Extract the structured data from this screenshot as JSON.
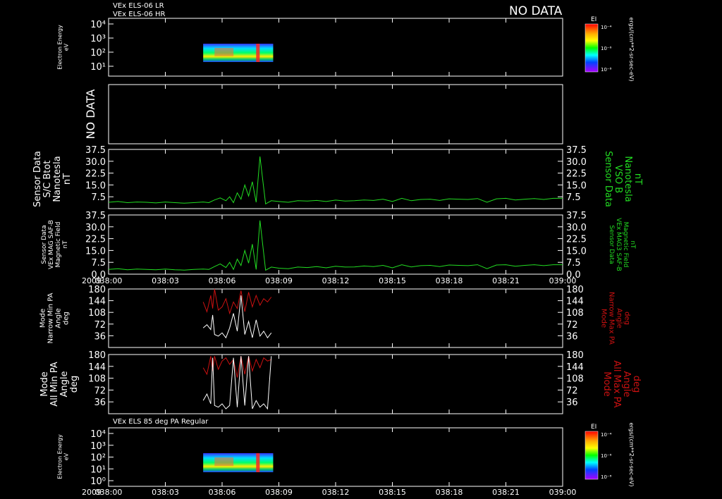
{
  "header": {
    "line1": "VEx ELS-06 LR",
    "line2": "VEx ELS-06 HR",
    "no_data": "NO DATA"
  },
  "colorbar": {
    "label": "EI",
    "ticks": [
      "10⁻⁴",
      "10⁻⁶",
      "10⁻⁸"
    ],
    "unit_label": "ergs/(cm**2-sr-sec-eV)"
  },
  "time_axis": {
    "year": "2009",
    "ticks": [
      "038:00",
      "038:03",
      "038:06",
      "038:09",
      "038:12",
      "038:15",
      "038:18",
      "038:21",
      "039:00"
    ]
  },
  "colors": {
    "green": "#22dd22",
    "red": "#cc1111",
    "white": "#ffffff",
    "background": "#000000"
  },
  "chart_data": [
    {
      "type": "heatmap",
      "panel": "electron-spectrogram-top",
      "left_label": [
        "Electron Energy",
        "eV"
      ],
      "y_ticks": [
        "10⁴",
        "10³",
        "10²",
        "10¹"
      ],
      "time_range": [
        "038:05",
        "038:09"
      ]
    },
    {
      "type": "empty",
      "panel": "no-data-panel",
      "left_label": [
        "NO DATA"
      ]
    },
    {
      "type": "line",
      "panel": "btot-panel",
      "left_label": [
        "Sensor Data",
        "S/C Btot",
        "Nanotesla",
        "nT"
      ],
      "right_label": [
        "Sensor Data",
        "VSO B",
        "Nanotesla",
        "nT"
      ],
      "y_ticks": [
        "37.5",
        "30.0",
        "22.5",
        "15.0",
        "7.5"
      ],
      "ylim": [
        0,
        37.5
      ],
      "series": [
        {
          "color": "#22dd22",
          "x": [
            0,
            0.5,
            1,
            1.5,
            2,
            2.5,
            3,
            3.5,
            4,
            4.5,
            5,
            5.3,
            5.6,
            5.9,
            6.2,
            6.4,
            6.6,
            6.8,
            7.0,
            7.2,
            7.4,
            7.6,
            7.8,
            8.0,
            8.3,
            8.6,
            9,
            9.5,
            10,
            10.5,
            11,
            11.5,
            12,
            12.5,
            13,
            13.5,
            14,
            14.5,
            15,
            15.5,
            16,
            16.5,
            17,
            17.5,
            18,
            18.5,
            19,
            19.5,
            20,
            20.5,
            21,
            21.5,
            22,
            22.5,
            23,
            23.5,
            24
          ],
          "values": [
            4,
            4.5,
            3.8,
            4.2,
            4,
            3.6,
            4.2,
            3.8,
            3.5,
            3.8,
            4.2,
            3.8,
            5.5,
            6.8,
            5,
            7.5,
            3.8,
            10,
            6,
            15,
            8,
            17,
            4,
            33,
            3,
            5,
            4.5,
            4,
            5,
            4.8,
            5.2,
            4.5,
            5.4,
            4.8,
            5,
            5.5,
            5.2,
            6,
            4.5,
            6.5,
            5,
            5.8,
            6,
            5.2,
            6.2,
            6,
            5.8,
            6.4,
            4,
            6.2,
            6.5,
            5.5,
            6,
            6.4,
            5.8,
            6.5,
            6.5
          ]
        }
      ]
    },
    {
      "type": "line",
      "panel": "mag-field-panel",
      "left_label": [
        "Sensor Data",
        "VEx MAG SAF-B",
        "Magnetic Field",
        "nT"
      ],
      "right_label": [
        "Sensor Data",
        "VEx MAG3 SAF-B",
        "Magnetic Field",
        "nT"
      ],
      "y_ticks": [
        "37.5",
        "30.0",
        "22.5",
        "15.0",
        "7.5",
        "0.0"
      ],
      "ylim": [
        0,
        37.5
      ],
      "series": [
        {
          "color": "#22dd22",
          "x": [
            0,
            0.5,
            1,
            1.5,
            2,
            2.5,
            3,
            3.5,
            4,
            4.5,
            5,
            5.3,
            5.6,
            5.9,
            6.2,
            6.4,
            6.6,
            6.8,
            7.0,
            7.2,
            7.4,
            7.6,
            7.8,
            8.0,
            8.3,
            8.6,
            9,
            9.5,
            10,
            10.5,
            11,
            11.5,
            12,
            12.5,
            13,
            13.5,
            14,
            14.5,
            15,
            15.5,
            16,
            16.5,
            17,
            17.5,
            18,
            18.5,
            19,
            19.5,
            20,
            20.5,
            21,
            21.5,
            22,
            22.5,
            23,
            23.5,
            24
          ],
          "values": [
            3,
            3.5,
            2.8,
            3.2,
            3,
            2.8,
            3.2,
            2.8,
            2.6,
            3,
            3.2,
            3,
            4.8,
            6.5,
            4.2,
            7.5,
            3,
            9.5,
            5.5,
            15,
            7,
            19,
            3,
            34,
            2.5,
            4.5,
            3.8,
            3.5,
            4.5,
            4.2,
            4.8,
            4,
            5,
            4.5,
            4.6,
            5.2,
            4.8,
            5.6,
            4,
            6,
            4.6,
            5.4,
            5.6,
            4.8,
            5.8,
            5.6,
            5.4,
            6,
            3.5,
            5.8,
            6,
            5,
            5.6,
            6,
            5.4,
            6,
            6
          ]
        }
      ]
    },
    {
      "type": "line",
      "panel": "narrow-pa-panel",
      "left_label": [
        "Mode",
        "Narrow Min PA",
        "Angle",
        "deg"
      ],
      "right_label": [
        "Mode",
        "Narrow Max PA",
        "Angle",
        "deg"
      ],
      "y_ticks": [
        "180",
        "144",
        "108",
        "72",
        "36"
      ],
      "ylim": [
        0,
        180
      ],
      "series": [
        {
          "color": "#cc1111",
          "x": [
            5.0,
            5.2,
            5.4,
            5.5,
            5.6,
            5.8,
            6.0,
            6.2,
            6.4,
            6.6,
            6.8,
            7.0,
            7.2,
            7.4,
            7.6,
            7.8,
            8.0,
            8.2,
            8.4,
            8.6
          ],
          "values": [
            140,
            110,
            160,
            120,
            180,
            115,
            125,
            150,
            105,
            140,
            120,
            175,
            110,
            170,
            125,
            160,
            130,
            150,
            140,
            155
          ]
        },
        {
          "color": "#ffffff",
          "x": [
            5.0,
            5.2,
            5.4,
            5.5,
            5.6,
            5.8,
            6.0,
            6.2,
            6.4,
            6.6,
            6.8,
            7.0,
            7.2,
            7.4,
            7.6,
            7.8,
            8.0,
            8.2,
            8.4,
            8.6
          ],
          "values": [
            60,
            70,
            55,
            100,
            40,
            35,
            45,
            30,
            60,
            105,
            50,
            160,
            40,
            80,
            30,
            85,
            35,
            50,
            30,
            45
          ]
        }
      ]
    },
    {
      "type": "line",
      "panel": "all-pa-panel",
      "left_label": [
        "Mode",
        "All Min PA",
        "Angle",
        "deg"
      ],
      "right_label": [
        "Mode",
        "All Max PA",
        "Angle",
        "deg"
      ],
      "y_ticks": [
        "180",
        "144",
        "108",
        "72",
        "36"
      ],
      "ylim": [
        0,
        180
      ],
      "series": [
        {
          "color": "#cc1111",
          "x": [
            5.0,
            5.2,
            5.4,
            5.5,
            5.6,
            5.8,
            6.0,
            6.2,
            6.4,
            6.6,
            6.8,
            7.0,
            7.2,
            7.4,
            7.6,
            7.8,
            8.0,
            8.2,
            8.4,
            8.6
          ],
          "values": [
            140,
            120,
            175,
            130,
            175,
            135,
            160,
            170,
            150,
            165,
            110,
            175,
            120,
            175,
            130,
            165,
            140,
            170,
            160,
            165
          ]
        },
        {
          "color": "#ffffff",
          "x": [
            5.0,
            5.2,
            5.4,
            5.5,
            5.6,
            5.8,
            6.0,
            6.2,
            6.4,
            6.6,
            6.8,
            7.0,
            7.2,
            7.4,
            7.6,
            7.8,
            8.0,
            8.2,
            8.4,
            8.6
          ],
          "values": [
            40,
            60,
            30,
            170,
            25,
            20,
            30,
            15,
            25,
            170,
            20,
            175,
            25,
            175,
            15,
            40,
            20,
            30,
            15,
            175
          ]
        }
      ]
    },
    {
      "type": "heatmap",
      "panel": "electron-spectrogram-bottom",
      "title": "VEx ELS 85 deg PA Regular",
      "left_label": [
        "Electron Energy",
        "eV"
      ],
      "y_ticks": [
        "10⁴",
        "10³",
        "10²",
        "10¹",
        "10⁰"
      ],
      "time_range": [
        "038:05",
        "038:09"
      ]
    }
  ]
}
